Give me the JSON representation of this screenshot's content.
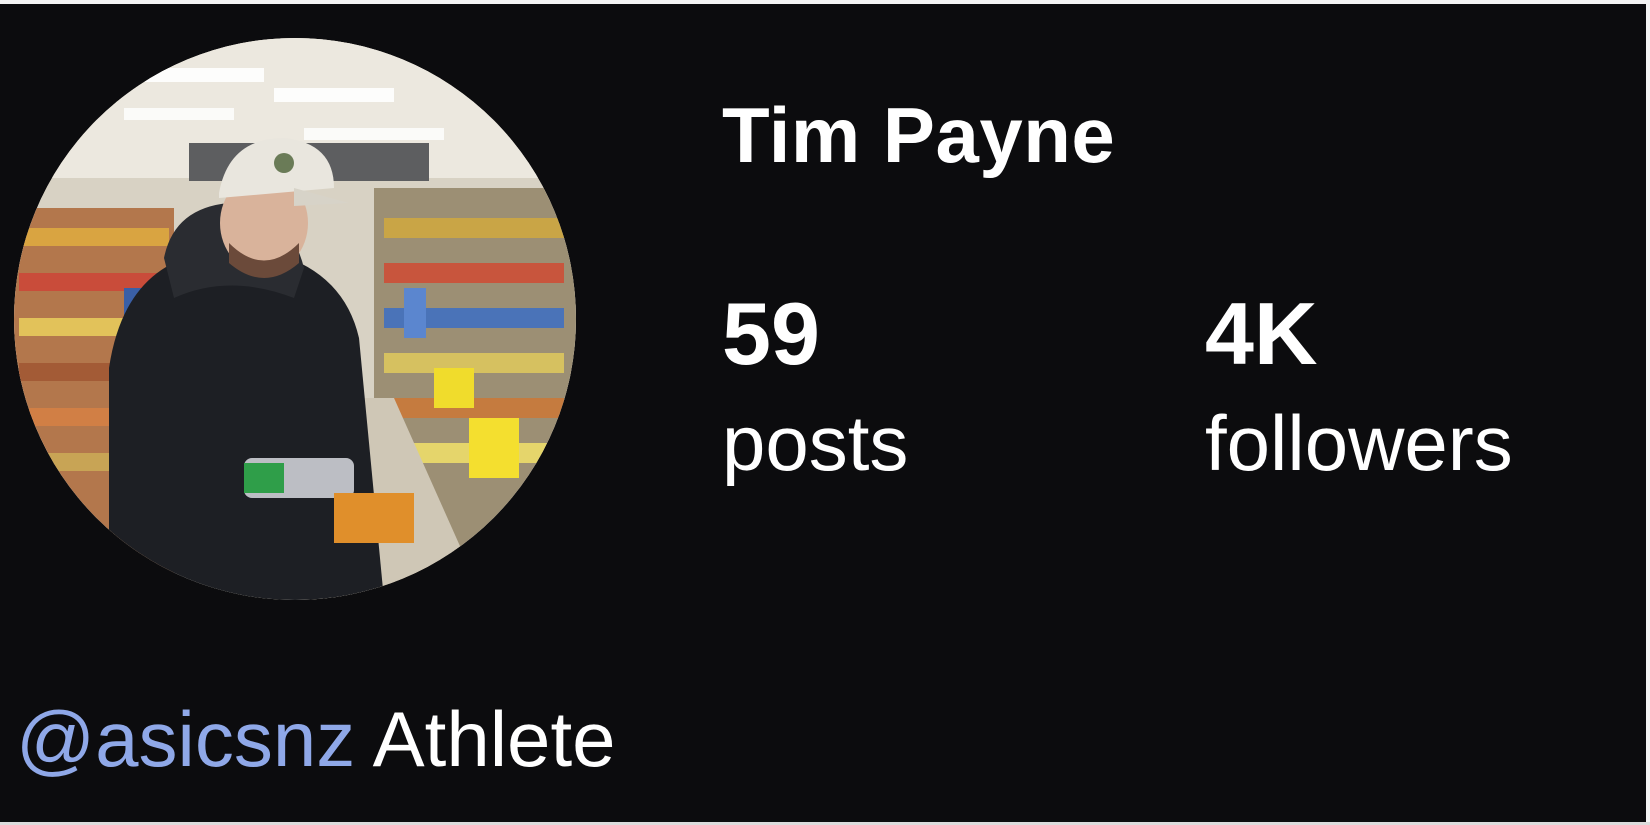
{
  "profile": {
    "name": "Tim Payne",
    "avatar_icon": "profile-photo",
    "stats": {
      "posts_value": "59",
      "posts_label": "posts",
      "followers_value": "4K",
      "followers_label": "followers"
    },
    "bio": {
      "mention": "@asicsnz",
      "text": "Athlete"
    }
  },
  "colors": {
    "background": "#0c0c0e",
    "text": "#ffffff",
    "mention": "#8fa8e8"
  }
}
